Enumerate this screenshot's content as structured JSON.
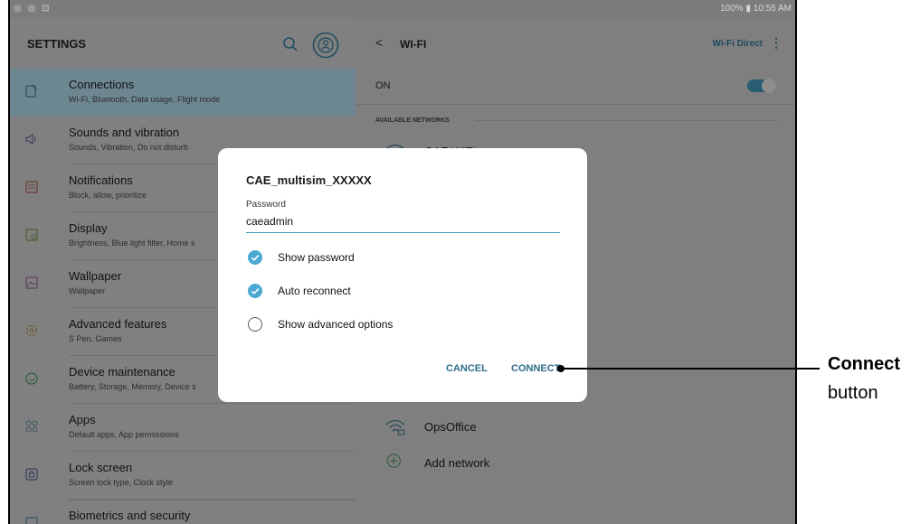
{
  "status_bar": {
    "left_icons": [
      "notification-icon",
      "notification-icon",
      "screenshot-icon"
    ],
    "battery": "100%",
    "time": "10:55 AM"
  },
  "settings": {
    "title": "SETTINGS",
    "items": [
      {
        "title": "Connections",
        "subtitle": "Wi-Fi, Bluetooth, Data usage, Flight mode",
        "icon": "connections-icon",
        "active": true
      },
      {
        "title": "Sounds and vibration",
        "subtitle": "Sounds, Vibration, Do not disturb",
        "icon": "speaker-icon"
      },
      {
        "title": "Notifications",
        "subtitle": "Block, allow, prioritize",
        "icon": "notifications-icon"
      },
      {
        "title": "Display",
        "subtitle": "Brightness, Blue light filter, Home s",
        "icon": "display-icon"
      },
      {
        "title": "Wallpaper",
        "subtitle": "Wallpaper",
        "icon": "wallpaper-icon"
      },
      {
        "title": "Advanced features",
        "subtitle": "S Pen, Games",
        "icon": "advanced-features-icon"
      },
      {
        "title": "Device maintenance",
        "subtitle": "Battery, Storage, Memory, Device s",
        "icon": "device-maintenance-icon"
      },
      {
        "title": "Apps",
        "subtitle": "Default apps, App permissions",
        "icon": "apps-icon"
      },
      {
        "title": "Lock screen",
        "subtitle": "Screen lock type, Clock style",
        "icon": "lock-screen-icon"
      },
      {
        "title": "Biometrics and security",
        "subtitle": "",
        "icon": "biometrics-icon"
      }
    ]
  },
  "wifi": {
    "title": "WI-FI",
    "wifi_direct": "Wi-Fi Direct",
    "on_label": "ON",
    "toggle_on": true,
    "available_label": "AVAILABLE NETWORKS",
    "networks": [
      {
        "name": "CAE WiFi",
        "icon": "wifi-icon"
      },
      {
        "name": "OpsOffice",
        "icon": "wifi-lock-icon"
      }
    ],
    "add_network": "Add network"
  },
  "dialog": {
    "network_name": "CAE_multisim_XXXXX",
    "password_label": "Password",
    "password_value": "caeadmin",
    "options": [
      {
        "label": "Show password",
        "checked": true
      },
      {
        "label": "Auto reconnect",
        "checked": true
      },
      {
        "label": "Show advanced options",
        "checked": false
      }
    ],
    "cancel": "CANCEL",
    "connect": "CONNECT"
  },
  "callout": {
    "strong": "Connect",
    "sub": "button"
  },
  "colors": {
    "accent": "#4aa8d2",
    "button_text": "#2e6d8c",
    "dim_overlay": "#7f7f7f"
  }
}
